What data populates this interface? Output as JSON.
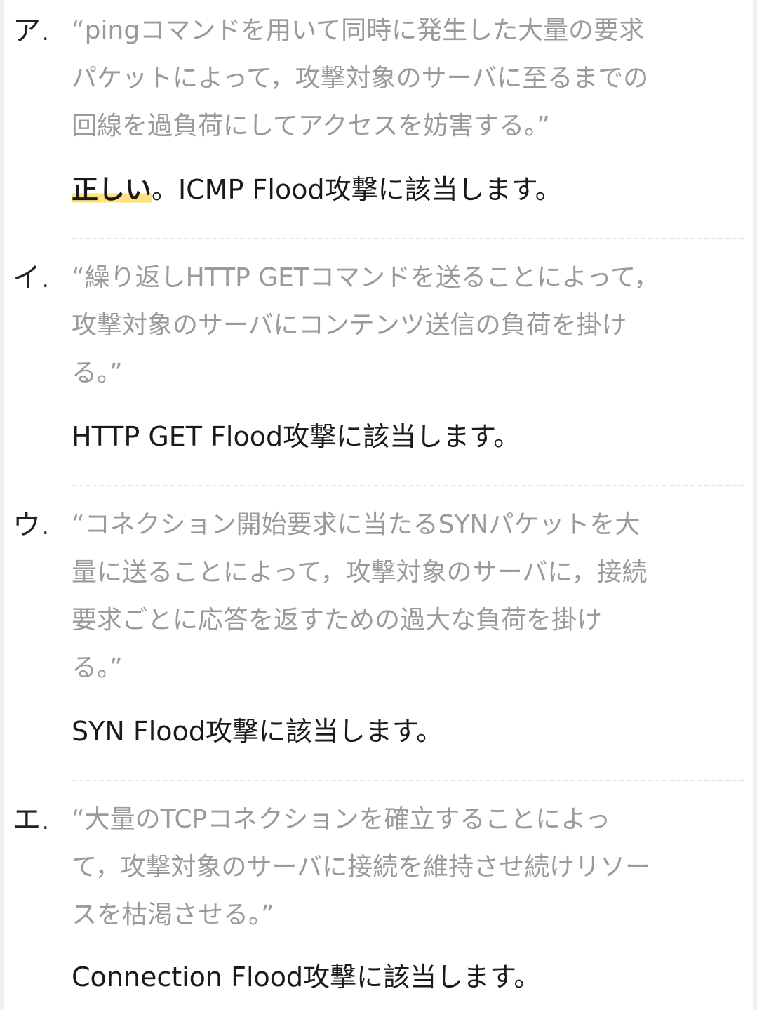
{
  "items": [
    {
      "marker": "ア",
      "quote_lines": [
        "“pingコマンドを用いて同時に発生した大量の要求",
        "パケットによって，攻撃対象のサーバに至るまでの",
        "回線を過負荷にしてアクセスを妨害する。”"
      ],
      "answer_highlight": "正しい",
      "answer_text": "。ICMP Flood攻撃に該当します。"
    },
    {
      "marker": "イ",
      "quote_lines": [
        "“繰り返しHTTP GETコマンドを送ることによって，",
        "攻撃対象のサーバにコンテンツ送信の負荷を掛け",
        "る。”"
      ],
      "answer_text": "HTTP GET Flood攻撃に該当します。"
    },
    {
      "marker": "ウ",
      "quote_lines": [
        "“コネクション開始要求に当たるSYNパケットを大",
        "量に送ることによって，攻撃対象のサーバに，接続",
        "要求ごとに応答を返すための過大な負荷を掛け",
        "る。”"
      ],
      "answer_text": "SYN Flood攻撃に該当します。"
    },
    {
      "marker": "エ",
      "quote_lines": [
        "“大量のTCPコネクションを確立することによっ",
        "て，攻撃対象のサーバに接続を維持させ続けリソー",
        "スを枯渇させる。”"
      ],
      "answer_text": "Connection Flood攻撃に該当します。"
    }
  ],
  "colors": {
    "quote": "#9a9a9a",
    "answer": "#1a1a1a",
    "highlight": "#ffe27a",
    "divider": "#e2e2e2"
  }
}
